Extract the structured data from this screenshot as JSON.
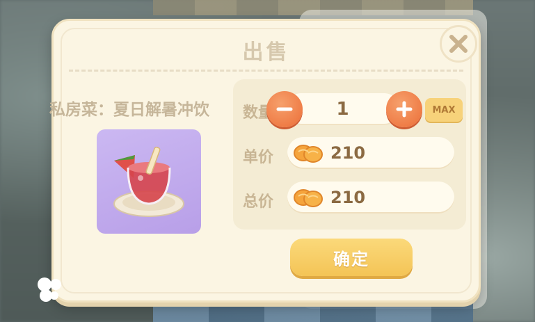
{
  "dialog": {
    "title": "出售",
    "item_name": "私房菜：夏日解暑冲饮",
    "quantity_label": "数量",
    "quantity_value": "1",
    "max_label": "MAX",
    "unit_price_label": "单价",
    "unit_price_value": "210",
    "total_price_label": "总价",
    "total_price_value": "210",
    "confirm_label": "确定"
  },
  "icons": {
    "close": "close-icon",
    "minus": "minus-icon",
    "plus": "plus-icon",
    "coin": "orange-slice-coin-icon",
    "item": "watermelon-drink-icon"
  },
  "colors": {
    "dialog_bg": "#fbf5e3",
    "accent_orange": "#ef7d47",
    "confirm_yellow": "#f4c456",
    "item_card_purple": "#b89fe8",
    "text_brown": "#8b6a42"
  }
}
